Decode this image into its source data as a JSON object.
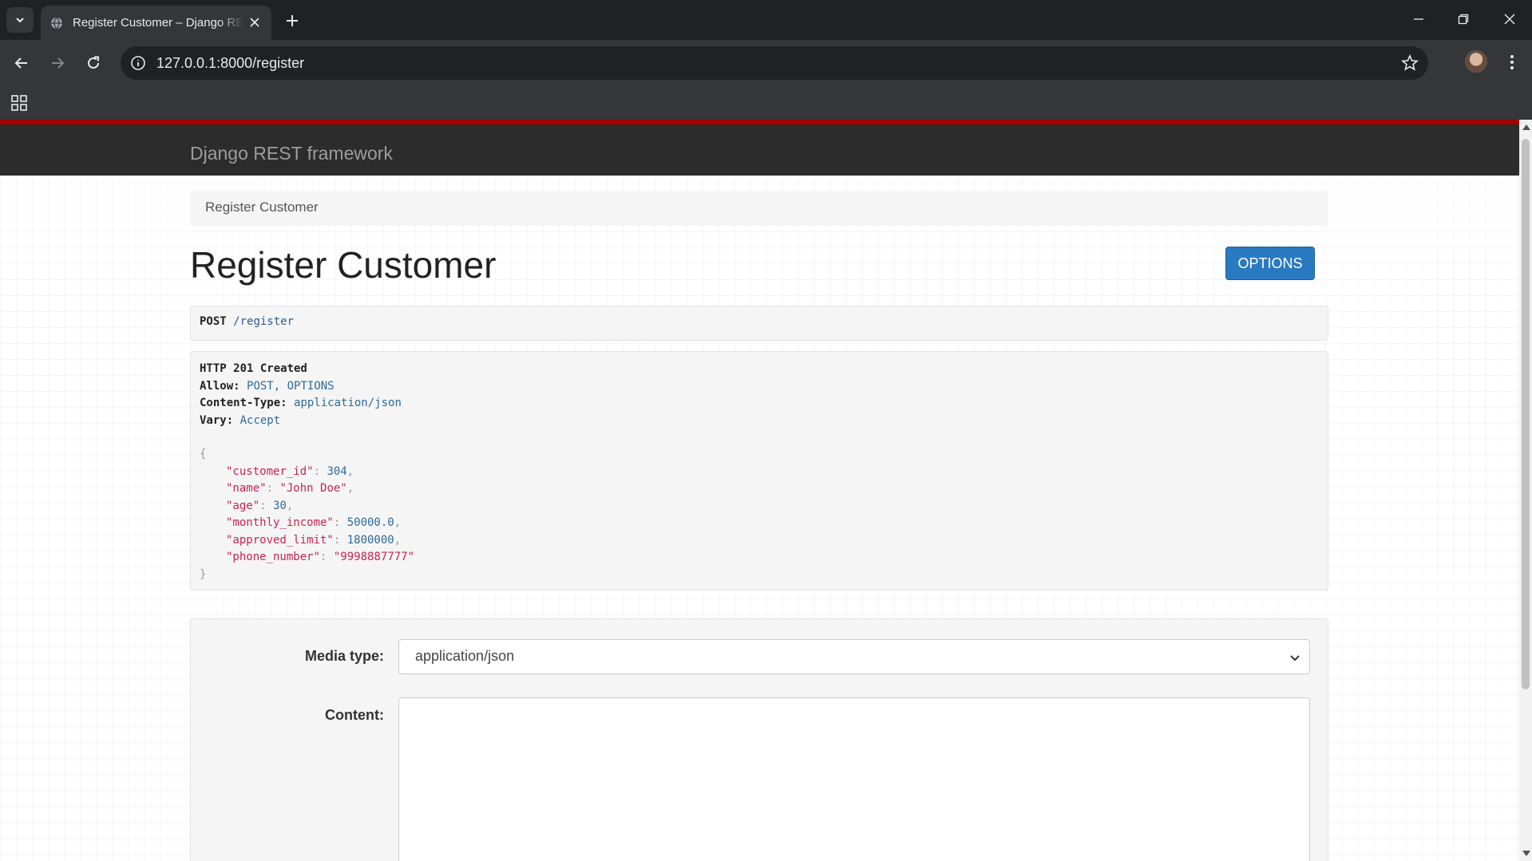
{
  "browser": {
    "tab_title": "Register Customer – Django REST framework",
    "url": "127.0.0.1:8000/register"
  },
  "page": {
    "brand": "Django REST framework",
    "breadcrumb": "Register Customer",
    "title": "Register Customer",
    "options_button": "OPTIONS",
    "request": {
      "method": "POST",
      "path": "/register"
    },
    "response": {
      "status": "HTTP 201 Created",
      "headers": [
        {
          "key": "Allow:",
          "value": "POST, OPTIONS"
        },
        {
          "key": "Content-Type:",
          "value": "application/json"
        },
        {
          "key": "Vary:",
          "value": "Accept"
        }
      ],
      "open_brace": "{",
      "close_brace": "}",
      "body": [
        {
          "key": "\"customer_id\"",
          "value": "304",
          "type": "number",
          "comma": ","
        },
        {
          "key": "\"name\"",
          "value": "\"John Doe\"",
          "type": "string",
          "comma": ","
        },
        {
          "key": "\"age\"",
          "value": "30",
          "type": "number",
          "comma": ","
        },
        {
          "key": "\"monthly_income\"",
          "value": "50000.0",
          "type": "number",
          "comma": ","
        },
        {
          "key": "\"approved_limit\"",
          "value": "1800000",
          "type": "number",
          "comma": ","
        },
        {
          "key": "\"phone_number\"",
          "value": "\"9998887777\"",
          "type": "string",
          "comma": ""
        }
      ]
    },
    "form": {
      "media_type_label": "Media type:",
      "media_type_value": "application/json",
      "content_label": "Content:"
    }
  },
  "colors": {
    "drf_red": "#a30000",
    "options_blue": "#2a7ac2"
  }
}
